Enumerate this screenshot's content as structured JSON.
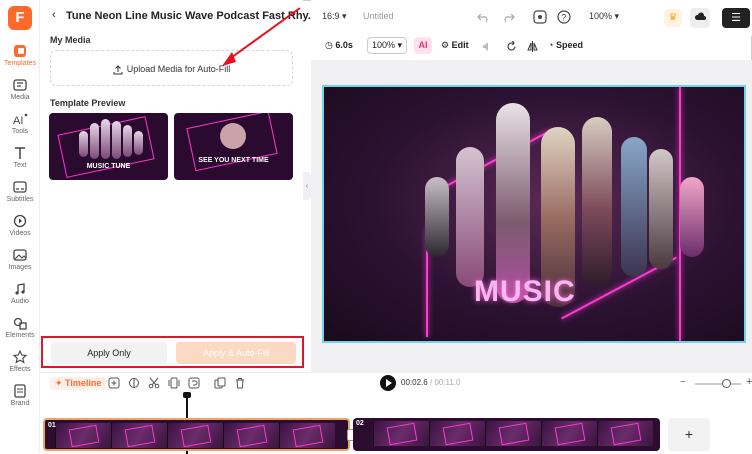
{
  "rail": {
    "logo": "F",
    "items": [
      {
        "label": "Templates",
        "icon": "templates-icon"
      },
      {
        "label": "Media",
        "icon": "media-icon"
      },
      {
        "label": "Tools",
        "icon": "tools-icon"
      },
      {
        "label": "Text",
        "icon": "text-icon"
      },
      {
        "label": "Subtitles",
        "icon": "subtitles-icon"
      },
      {
        "label": "Videos",
        "icon": "videos-icon"
      },
      {
        "label": "Images",
        "icon": "images-icon"
      },
      {
        "label": "Audio",
        "icon": "audio-icon"
      },
      {
        "label": "Elements",
        "icon": "elements-icon"
      },
      {
        "label": "Effects",
        "icon": "effects-icon"
      },
      {
        "label": "Brand",
        "icon": "brand-icon"
      }
    ]
  },
  "panel": {
    "title": "Tune Neon Line Music Wave Podcast Fast Rhy...",
    "my_media_heading": "My Media",
    "upload_label": "Upload Media for Auto-Fill",
    "template_preview_heading": "Template Preview",
    "previews": [
      {
        "caption": "MUSIC TUNE"
      },
      {
        "caption": "SEE YOU NEXT TIME"
      }
    ],
    "apply_only": "Apply Only",
    "apply_autofill": "Apply & Auto-Fill"
  },
  "topbar": {
    "aspect": "16:9",
    "doc_title": "Untitled",
    "zoom": "100%"
  },
  "toolbar": {
    "duration": "6.0s",
    "scale": "100%",
    "ai_label": "AI",
    "edit": "Edit",
    "speed": "Speed"
  },
  "canvas": {
    "text": "MUSIC"
  },
  "timeline": {
    "label": "Timeline",
    "current_time": "00:02.6",
    "total_time": "/ 00:11.0",
    "clips": [
      {
        "num": "01"
      },
      {
        "num": "02"
      }
    ],
    "add": "+"
  },
  "colors": {
    "brand": "#ff6a2b",
    "highlight_box": "#d9182c",
    "canvas_border": "#6ed4e6",
    "neon": "#ff3bd0"
  }
}
